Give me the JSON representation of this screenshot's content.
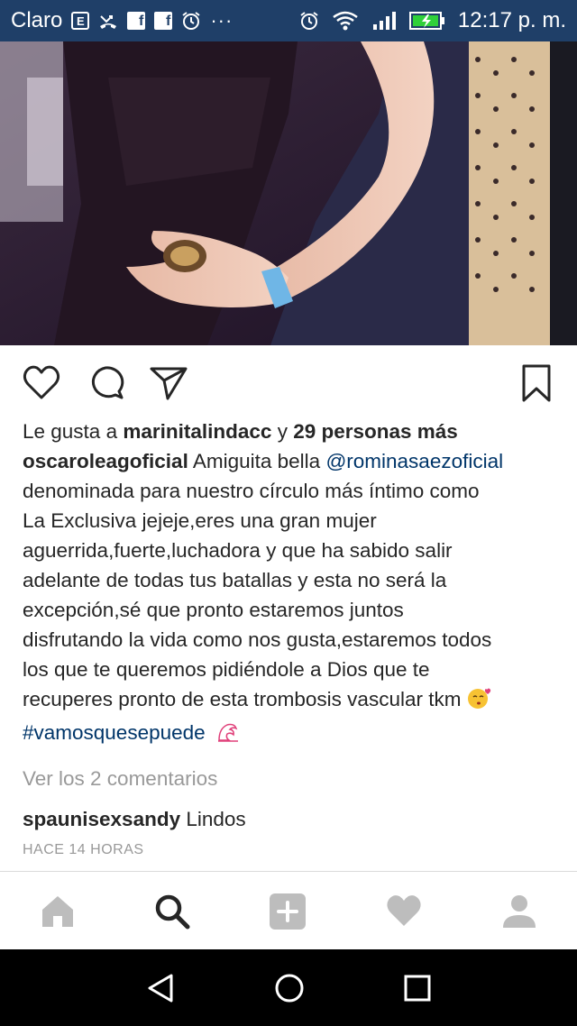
{
  "status_bar": {
    "carrier": "Claro",
    "time": "12:17 p. m."
  },
  "post": {
    "likes": {
      "prefix": "Le gusta a",
      "user": "marinitalindacc",
      "connector": "y",
      "others": "29 personas más"
    },
    "caption": {
      "author": "oscaroleagoficial",
      "line1_text": "Amiguita bella",
      "mention": "@rominasaezoficial",
      "lines": [
        "denominada para nuestro círculo más íntimo como",
        "La Exclusiva jejeje,eres una gran mujer",
        "aguerrida,fuerte,luchadora y que ha sabido salir",
        "adelante de todas tus batallas y esta no será la",
        "excepción,sé que pronto estaremos juntos",
        "disfrutando la vida como nos gusta,estaremos todos",
        "los que te queremos pidiéndole a Dios que te",
        "recuperes pronto de esta trombosis vascular tkm"
      ],
      "hashtag": "#vamosquesepuede"
    },
    "view_comments": "Ver los 2 comentarios",
    "comment": {
      "user": "spaunisexsandy",
      "text": "Lindos"
    },
    "timestamp": "HACE 14 HORAS"
  },
  "icons": {
    "like": "heart-outline-icon",
    "comment": "speech-bubble-icon",
    "share": "paper-plane-icon",
    "save": "bookmark-icon"
  },
  "nav": {
    "items": [
      "home",
      "search",
      "add",
      "activity",
      "profile"
    ],
    "active": "search"
  },
  "colors": {
    "status_bar": "#1f3f68",
    "link": "#003569",
    "muted": "#999999"
  }
}
